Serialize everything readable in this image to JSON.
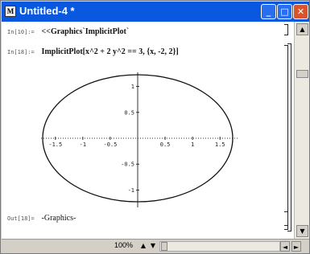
{
  "window": {
    "title": "Untitled-4 *",
    "icon_glyph": "M"
  },
  "cells": {
    "in10_label": "In[10]:=",
    "in10_code": "<<Graphics`ImplicitPlot`",
    "in18_label": "In[18]:=",
    "in18_code": "ImplicitPlot[x^2 + 2 y^2 == 3, {x, -2, 2}]",
    "out18_label": "Out[18]=",
    "out18_value": "-Graphics-"
  },
  "chart_data": {
    "type": "line",
    "equation": "x^2 + 2 y^2 == 3",
    "x_range": [
      -2,
      2
    ],
    "x_ticks": [
      "-1.5",
      "-1",
      "-0.5",
      "0.5",
      "1",
      "1.5"
    ],
    "y_ticks": [
      "1",
      "0.5",
      "-0.5",
      "-1"
    ],
    "x_tick_values": [
      -1.5,
      -1,
      -0.5,
      0.5,
      1,
      1.5
    ],
    "y_tick_values": [
      1,
      0.5,
      -0.5,
      -1
    ],
    "semi_axis_x": 1.732,
    "semi_axis_y": 1.225
  },
  "status": {
    "zoom": "100%"
  },
  "colors": {
    "titlebar": "#0a58e0",
    "close_button": "#d9542a"
  },
  "icons": {
    "minimize": "_",
    "maximize": "□",
    "close": "✕",
    "up": "▲",
    "down": "▼",
    "left": "◄",
    "right": "►"
  }
}
